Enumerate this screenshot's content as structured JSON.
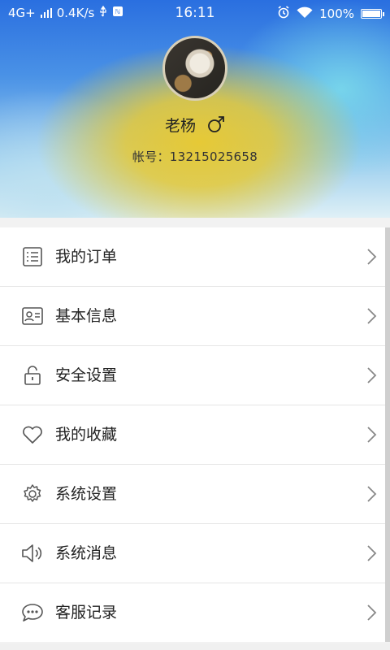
{
  "status_bar": {
    "network": "4G+",
    "speed": "0.4K/s",
    "time": "16:11",
    "battery": "100%"
  },
  "profile": {
    "name": "老杨",
    "account": "帐号：13215025658"
  },
  "menu": {
    "items": [
      {
        "label": "我的订单",
        "icon": "order-list-icon"
      },
      {
        "label": "基本信息",
        "icon": "id-card-icon"
      },
      {
        "label": "安全设置",
        "icon": "lock-icon"
      },
      {
        "label": "我的收藏",
        "icon": "heart-icon"
      },
      {
        "label": "系统设置",
        "icon": "gear-icon"
      },
      {
        "label": "系统消息",
        "icon": "speaker-icon"
      },
      {
        "label": "客服记录",
        "icon": "chat-bubble-icon"
      }
    ]
  },
  "colors": {
    "accent_yellow": "#e6c936",
    "hero_blue": "#2a6fe0",
    "text": "#222222",
    "icon": "#555555"
  }
}
